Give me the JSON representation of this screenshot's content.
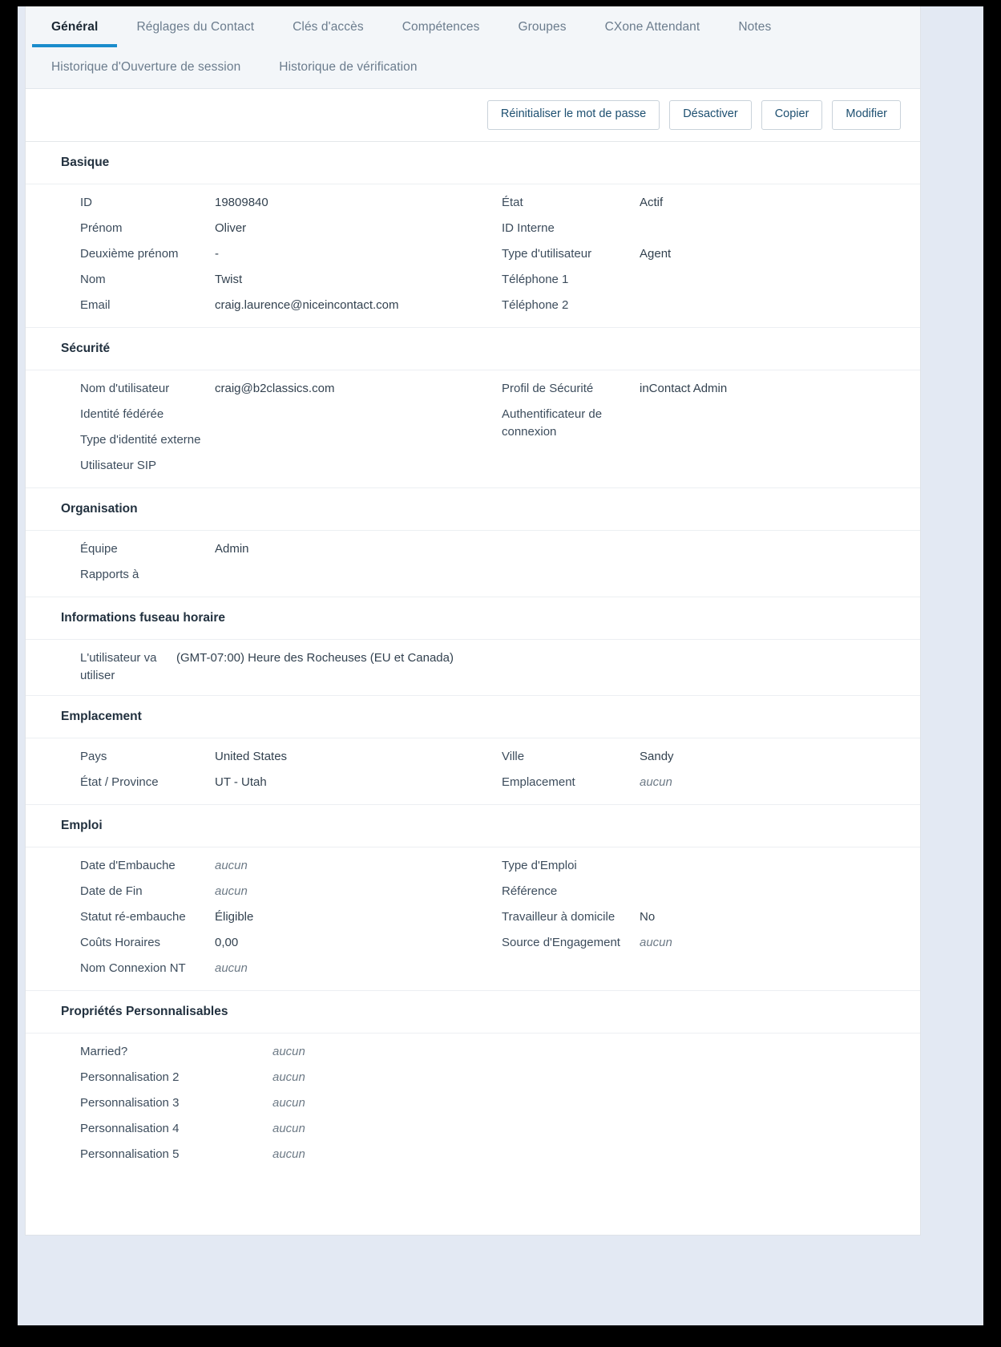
{
  "tabs": {
    "row1": [
      {
        "label": "Général",
        "active": true
      },
      {
        "label": "Réglages du Contact",
        "active": false
      },
      {
        "label": "Clés d'accès",
        "active": false
      },
      {
        "label": "Compétences",
        "active": false
      },
      {
        "label": "Groupes",
        "active": false
      },
      {
        "label": "CXone Attendant",
        "active": false
      },
      {
        "label": "Notes",
        "active": false
      }
    ],
    "row2": [
      {
        "label": "Historique d'Ouverture de session",
        "active": false
      },
      {
        "label": "Historique de vérification",
        "active": false
      }
    ]
  },
  "actions": {
    "reset_password": "Réinitialiser le mot de passe",
    "deactivate": "Désactiver",
    "copy": "Copier",
    "edit": "Modifier"
  },
  "sections": {
    "basique": {
      "title": "Basique",
      "left": [
        {
          "label": "ID",
          "value": "19809840",
          "none": false
        },
        {
          "label": "Prénom",
          "value": "Oliver",
          "none": false
        },
        {
          "label": "Deuxième prénom",
          "value": "-",
          "none": false
        },
        {
          "label": "Nom",
          "value": "Twist",
          "none": false
        },
        {
          "label": "Email",
          "value": "craig.laurence@niceincontact.com",
          "none": false
        }
      ],
      "right": [
        {
          "label": "État",
          "value": "Actif",
          "none": false
        },
        {
          "label": "ID Interne",
          "value": "",
          "none": false
        },
        {
          "label": "Type d'utilisateur",
          "value": "Agent",
          "none": false
        },
        {
          "label": "Téléphone 1",
          "value": "",
          "none": false
        },
        {
          "label": "Téléphone 2",
          "value": "",
          "none": false
        }
      ]
    },
    "securite": {
      "title": "Sécurité",
      "left": [
        {
          "label": "Nom d'utilisateur",
          "value": "craig@b2classics.com",
          "none": false
        },
        {
          "label": "Identité fédérée",
          "value": "",
          "none": false
        },
        {
          "label": "Type d'identité externe",
          "value": "",
          "none": false
        },
        {
          "label": "Utilisateur SIP",
          "value": "",
          "none": false
        }
      ],
      "right": [
        {
          "label": "Profil de Sécurité",
          "value": "inContact Admin",
          "none": false
        },
        {
          "label": "Authentificateur de connexion",
          "value": "",
          "none": false
        }
      ]
    },
    "organisation": {
      "title": "Organisation",
      "left": [
        {
          "label": "Équipe",
          "value": "Admin",
          "none": false
        },
        {
          "label": "Rapports à",
          "value": "",
          "none": false
        }
      ],
      "right": []
    },
    "fuseau": {
      "title": "Informations fuseau horaire",
      "left": [
        {
          "label": "L'utilisateur va utiliser",
          "value": "(GMT-07:00) Heure des Rocheuses (EU et Canada)",
          "none": false
        }
      ],
      "right": []
    },
    "emplacement": {
      "title": "Emplacement",
      "left": [
        {
          "label": "Pays",
          "value": "United States",
          "none": false
        },
        {
          "label": "État / Province",
          "value": "UT - Utah",
          "none": false
        }
      ],
      "right": [
        {
          "label": "Ville",
          "value": "Sandy",
          "none": false
        },
        {
          "label": "Emplacement",
          "value": "aucun",
          "none": true
        }
      ]
    },
    "emploi": {
      "title": "Emploi",
      "left": [
        {
          "label": "Date d'Embauche",
          "value": "aucun",
          "none": true
        },
        {
          "label": "Date de Fin",
          "value": "aucun",
          "none": true
        },
        {
          "label": "Statut ré-embauche",
          "value": "Éligible",
          "none": false
        },
        {
          "label": "Coûts Horaires",
          "value": "0,00",
          "none": false
        },
        {
          "label": "Nom Connexion NT",
          "value": "aucun",
          "none": true
        }
      ],
      "right": [
        {
          "label": "Type d'Emploi",
          "value": "",
          "none": false
        },
        {
          "label": "Référence",
          "value": "",
          "none": false
        },
        {
          "label": "Travailleur à domicile",
          "value": "No",
          "none": false
        },
        {
          "label": "Source d'Engagement",
          "value": "aucun",
          "none": true
        }
      ]
    },
    "proprietes": {
      "title": "Propriétés Personnalisables",
      "left": [
        {
          "label": "Married?",
          "value": "aucun",
          "none": true
        },
        {
          "label": "Personnalisation 2",
          "value": "aucun",
          "none": true
        },
        {
          "label": "Personnalisation 3",
          "value": "aucun",
          "none": true
        },
        {
          "label": "Personnalisation 4",
          "value": "aucun",
          "none": true
        },
        {
          "label": "Personnalisation 5",
          "value": "aucun",
          "none": true
        }
      ],
      "right": []
    }
  },
  "colors": {
    "accent": "#1a8ccc",
    "tab_bar_bg": "#f3f6f9",
    "page_bg": "#e3e9f3",
    "button_text": "#1d4f70",
    "heading_text": "#22313f"
  }
}
